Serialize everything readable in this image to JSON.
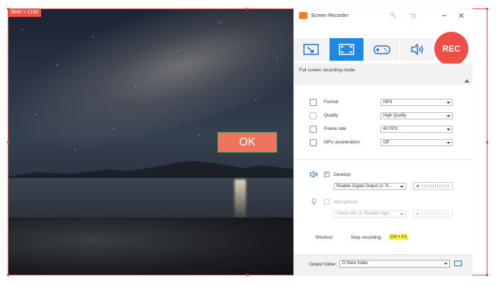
{
  "capture": {
    "resolution_badge": "3840 × 2160",
    "ok_button_label": "OK"
  },
  "window": {
    "title": "Screen Recorder",
    "icons": [
      "key-icon",
      "cart-icon",
      "minimize-icon",
      "close-icon"
    ]
  },
  "modes": {
    "items": [
      {
        "name": "region",
        "icon": "region-capture-icon"
      },
      {
        "name": "fullscreen",
        "icon": "fullscreen-icon",
        "active": true
      },
      {
        "name": "game",
        "icon": "gamepad-icon"
      },
      {
        "name": "audio",
        "icon": "speaker-icon"
      }
    ],
    "rec_label": "REC",
    "description": "Full screen recording mode."
  },
  "settings": {
    "format": {
      "label": "Format",
      "value": "MP4"
    },
    "quality": {
      "label": "Quality",
      "value": "High Quality"
    },
    "frame_rate": {
      "label": "Frame rate",
      "value": "60 FPS"
    },
    "gpu": {
      "label": "GPU acceleration",
      "value": "Off"
    }
  },
  "audio": {
    "desktop": {
      "label": "Desktop",
      "checked": true,
      "device": "Realtek Digital Output (2- R..."
    },
    "microphone": {
      "label": "Microphone",
      "checked": false,
      "device": "Stereo Mix (2- Realtek High..."
    }
  },
  "shortcut": {
    "label": "Shortcut",
    "stop_label": "Stop recording:",
    "stop_keys": "Ctrl + F1"
  },
  "output": {
    "label": "Output folder:",
    "path": "D:\\New folder"
  },
  "colors": {
    "accent": "#1e88e5",
    "rec": "#ef4d45",
    "border_red": "#e74c3c",
    "hotkey_highlight": "#f6f338"
  }
}
